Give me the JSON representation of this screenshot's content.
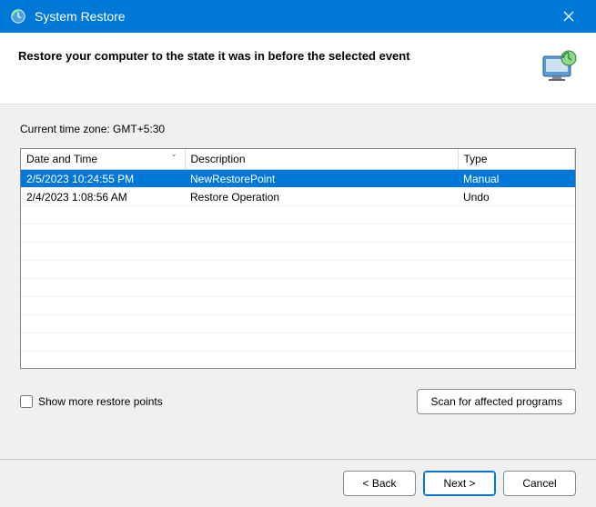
{
  "titlebar": {
    "title": "System Restore"
  },
  "header": {
    "instruction": "Restore your computer to the state it was in before the selected event"
  },
  "timezone_label": "Current time zone: GMT+5:30",
  "table": {
    "columns": {
      "datetime": "Date and Time",
      "description": "Description",
      "type": "Type"
    },
    "rows": [
      {
        "datetime": "2/5/2023 10:24:55 PM",
        "description": "NewRestorePoint",
        "type": "Manual",
        "selected": true
      },
      {
        "datetime": "2/4/2023 1:08:56 AM",
        "description": "Restore Operation",
        "type": "Undo",
        "selected": false
      }
    ]
  },
  "show_more": {
    "label": "Show more restore points",
    "checked": false
  },
  "buttons": {
    "scan": "Scan for affected programs",
    "back": "< Back",
    "next": "Next >",
    "cancel": "Cancel"
  }
}
